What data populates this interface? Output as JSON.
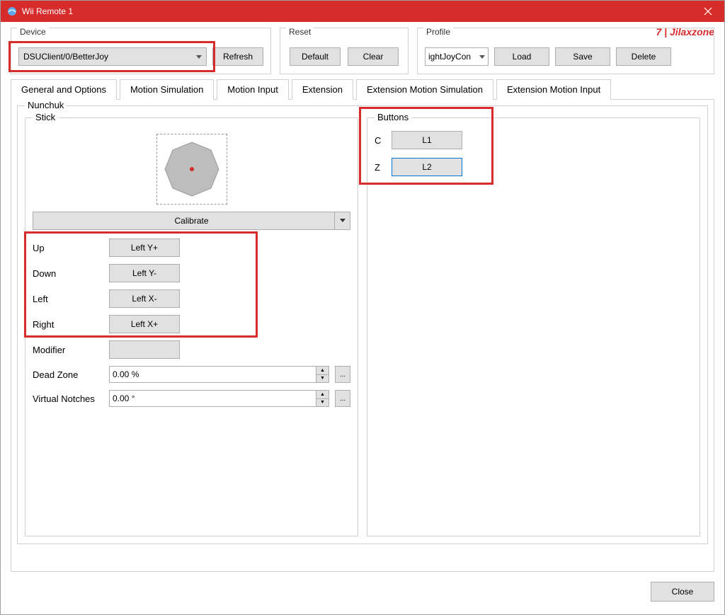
{
  "window": {
    "title": "Wii Remote 1"
  },
  "watermark": "7 | Jilaxzone",
  "device_group": {
    "label": "Device",
    "selected": "DSUClient/0/BetterJoy",
    "refresh": "Refresh"
  },
  "reset_group": {
    "label": "Reset",
    "default": "Default",
    "clear": "Clear"
  },
  "profile_group": {
    "label": "Profile",
    "value": "ightJoyCon",
    "load": "Load",
    "save": "Save",
    "delete": "Delete"
  },
  "tabs": {
    "general": "General and Options",
    "motion_sim": "Motion Simulation",
    "motion_input": "Motion Input",
    "extension": "Extension",
    "ext_motion_sim": "Extension Motion Simulation",
    "ext_motion_input": "Extension Motion Input"
  },
  "nunchuk": {
    "label": "Nunchuk",
    "stick": {
      "label": "Stick",
      "calibrate": "Calibrate",
      "up": {
        "label": "Up",
        "value": "Left Y+"
      },
      "down": {
        "label": "Down",
        "value": "Left Y-"
      },
      "left": {
        "label": "Left",
        "value": "Left X-"
      },
      "right": {
        "label": "Right",
        "value": "Left X+"
      },
      "modifier": {
        "label": "Modifier",
        "value": ""
      },
      "deadzone": {
        "label": "Dead Zone",
        "value": "0.00 %"
      },
      "virtual_notches": {
        "label": "Virtual Notches",
        "value": "0.00 °"
      }
    },
    "buttons": {
      "label": "Buttons",
      "c": {
        "label": "C",
        "value": "L1"
      },
      "z": {
        "label": "Z",
        "value": "L2"
      }
    }
  },
  "close": "Close",
  "ellipsis": "..."
}
